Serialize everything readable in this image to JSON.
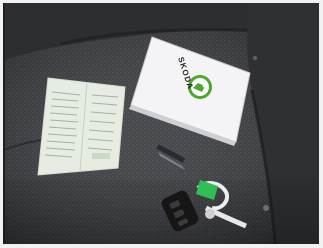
{
  "photo": {
    "brand_text": "SKODA",
    "colors": {
      "frame": "#f2f2f2",
      "seat_dark": "#2b2d30",
      "seat_mid": "#3a3c40",
      "seat_light": "#54575c",
      "booklet_cover": "#f4f4f6",
      "logo_green": "#4ba82e",
      "paper": "#e6ece2",
      "paper_text": "#8aa08a",
      "key_black": "#161616",
      "tag_green": "#2fbf52",
      "keyring_white": "#eeeeee"
    }
  }
}
